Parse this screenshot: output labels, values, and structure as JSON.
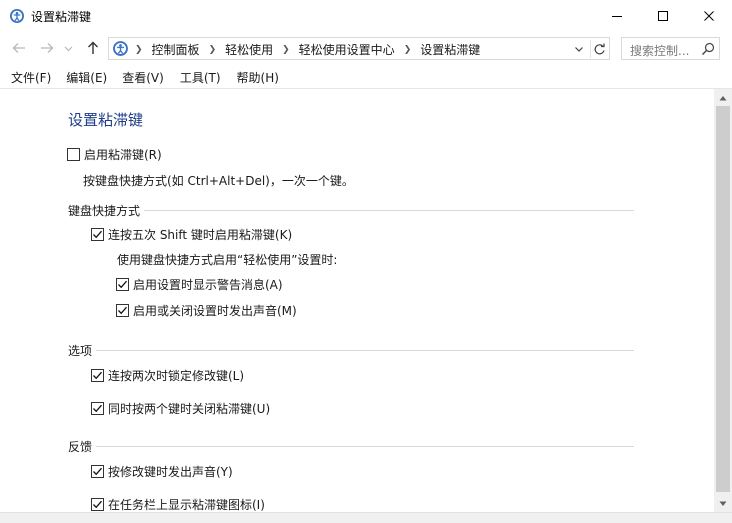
{
  "window": {
    "title": "设置粘滞键"
  },
  "nav": {
    "breadcrumbs": [
      "控制面板",
      "轻松使用",
      "轻松使用设置中心",
      "设置粘滞键"
    ],
    "search_placeholder": "搜索控制..."
  },
  "menu": [
    "文件(F)",
    "编辑(E)",
    "查看(V)",
    "工具(T)",
    "帮助(H)"
  ],
  "content": {
    "title": "设置粘滞键",
    "enable": {
      "label": "启用粘滞键(R)",
      "checked": false
    },
    "enable_hint": "按键盘快捷方式(如 Ctrl+Alt+Del)，一次一个键。",
    "shortcut_section": "键盘快捷方式",
    "shift_five": {
      "label": "连按五次 Shift 键时启用粘滞键(K)",
      "checked": true
    },
    "shortcut_hint": "使用键盘快捷方式启用“轻松使用”设置时:",
    "show_warning": {
      "label": "启用设置时显示警告消息(A)",
      "checked": true
    },
    "make_sound": {
      "label": "启用或关闭设置时发出声音(M)",
      "checked": true
    },
    "options_section": "选项",
    "lock_modifier": {
      "label": "连按两次时锁定修改键(L)",
      "checked": true
    },
    "turn_off_two": {
      "label": "同时按两个键时关闭粘滞键(U)",
      "checked": true
    },
    "feedback_section": "反馈",
    "modifier_sound": {
      "label": "按修改键时发出声音(Y)",
      "checked": true
    },
    "taskbar_icon": {
      "label": "在任务栏上显示粘滞键图标(I)",
      "checked": true
    }
  },
  "colors": {
    "title_blue": "#1e3e8a",
    "scroll_thumb": "#cdcdcd"
  }
}
